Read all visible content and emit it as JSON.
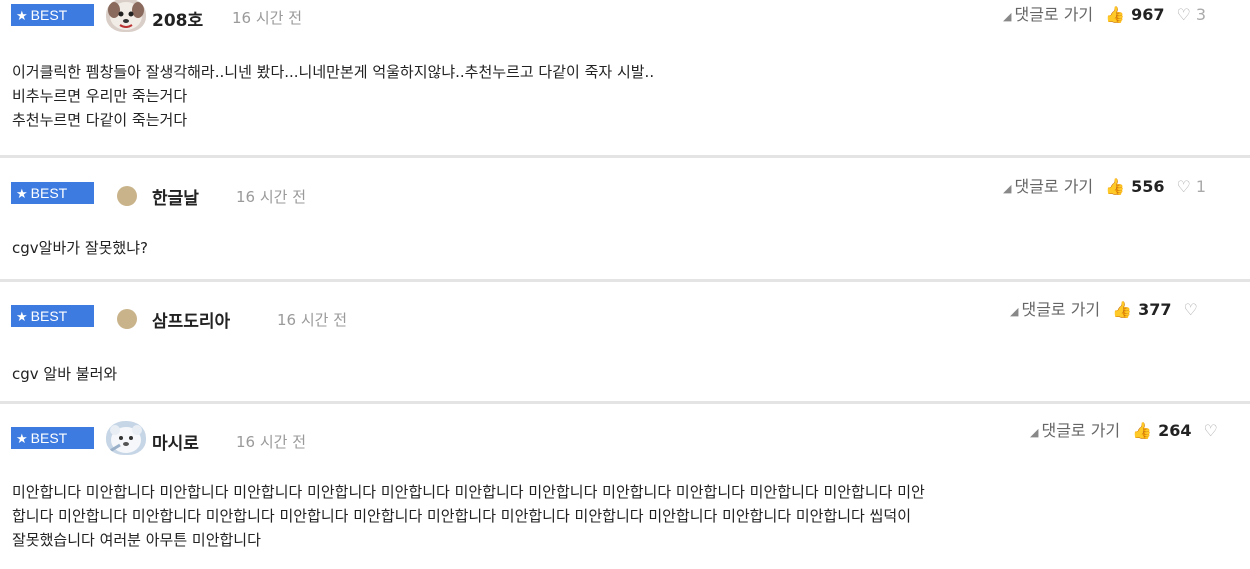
{
  "comments": [
    {
      "badge": "BEST",
      "nickname": "208호",
      "time": "16 시간 전",
      "goto_label": "댓글로 가기",
      "likes": "967",
      "dislikes": "3",
      "lines": [
        "이거클릭한 펨창들아 잘생각해라..니넨 봤다...니네만본게 억울하지않냐..추천누르고 다같이 죽자 시발..",
        "비추누르면 우리만 죽는거다",
        "추천누르면 다같이 죽는거다"
      ]
    },
    {
      "badge": "BEST",
      "nickname": "한글날",
      "time": "16 시간 전",
      "goto_label": "댓글로 가기",
      "likes": "556",
      "dislikes": "1",
      "lines": [
        "cgv알바가 잘못했냐?"
      ]
    },
    {
      "badge": "BEST",
      "nickname": "삼프도리아",
      "time": "16 시간 전",
      "goto_label": "댓글로 가기",
      "likes": "377",
      "dislikes": "",
      "lines": [
        "cgv 알바 불러와"
      ]
    },
    {
      "badge": "BEST",
      "nickname": "마시로",
      "time": "16 시간 전",
      "goto_label": "댓글로 가기",
      "likes": "264",
      "dislikes": "",
      "lines": [
        "미안합니다 미안합니다 미안합니다 미안합니다 미안합니다 미안합니다 미안합니다 미안합니다 미안합니다 미안합니다 미안합니다 미안합니다 미안",
        "합니다 미안합니다 미안합니다 미안합니다 미안합니다 미안합니다 미안합니다 미안합니다 미안합니다 미안합니다 미안합니다 미안합니다 씹덕이",
        "잘못했습니다 여러분 아무튼 미안합니다"
      ]
    }
  ],
  "colors": {
    "badge_bg": "#3d7be0",
    "divider": "#e4e4e4",
    "time_text": "#9a9a9a"
  }
}
